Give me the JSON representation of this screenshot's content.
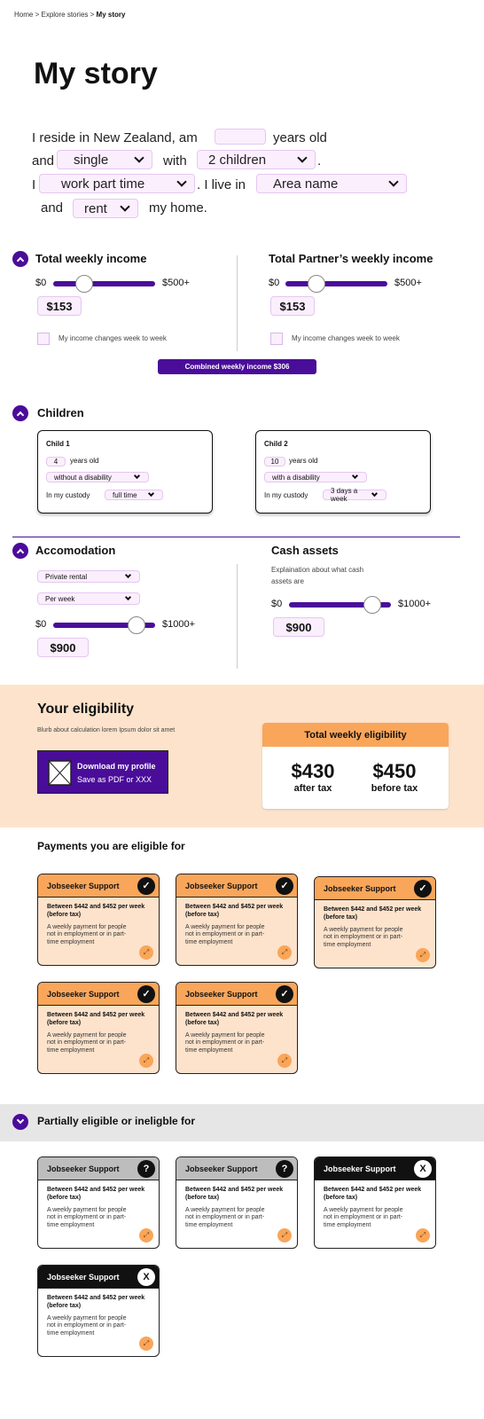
{
  "breadcrumb": {
    "home": "Home",
    "sep1": ">",
    "explore": "Explore stories",
    "sep2": ">",
    "current": "My story"
  },
  "title": "My story",
  "story": {
    "t1": "I reside in New Zealand, am",
    "age_value": "",
    "t2": "years old",
    "t3": "and",
    "status_value": "single",
    "t4": "with",
    "children_value": "2 children",
    "t5": ".",
    "t6": "I",
    "work_value": "work part time",
    "t7": ". I live in",
    "area_value": "Area name",
    "t8": "and",
    "tenure_value": "rent",
    "t9": "my home."
  },
  "income": {
    "title": "Total weekly income",
    "min": "$0",
    "max": "$500+",
    "value": "$153",
    "level": 0.3,
    "checkbox_label": "My income changes week to week"
  },
  "partner_income": {
    "title": "Total Partner’s weekly income",
    "min": "$0",
    "max": "$500+",
    "value": "$153",
    "level": 0.3,
    "checkbox_label": "My income changes week to week"
  },
  "combined": "Combined weekly income $306",
  "children": {
    "title": "Children",
    "items": [
      {
        "name": "Child 1",
        "age": "4",
        "years": "years old",
        "disability": "without a disability",
        "custody_label": "In my custody",
        "custody": "full time"
      },
      {
        "name": "Child 2",
        "age": "10",
        "years": "years old",
        "disability": "with a disability",
        "custody_label": "In my custody",
        "custody": "3 days a week"
      }
    ]
  },
  "accommodation": {
    "title": "Accomodation",
    "type": "Private rental",
    "period": "Per week",
    "min": "$0",
    "max": "$1000+",
    "value": "$900",
    "level": 0.82
  },
  "cash": {
    "title": "Cash assets",
    "explain": "Explaination about what cash assets are",
    "min": "$0",
    "max": "$1000+",
    "value": "$900",
    "level": 0.82
  },
  "eligibility": {
    "title": "Your eligibility",
    "blurb": "Blurb about calculation lorem Ipsum dolor sit amet",
    "download_title": "Download my profile",
    "download_sub": "Save as PDF or XXX",
    "box_title": "Total weekly eligibility",
    "after_amount": "$430",
    "after_label": "after tax",
    "before_amount": "$450",
    "before_label": "before tax"
  },
  "eligible": {
    "title": "Payments you are eligible for",
    "cards": [
      {
        "name": "Jobseeker Support",
        "amount": "Between $442 and $452 per week (before tax)",
        "desc": "A weekly payment for people not in employment or in part-time employment",
        "badge": "✓"
      },
      {
        "name": "Jobseeker Support",
        "amount": "Between $442 and $452 per week (before tax)",
        "desc": "A weekly payment for people not in employment or in part-time employment",
        "badge": "✓"
      },
      {
        "name": "Jobseeker Support",
        "amount": "Between $442 and $452 per week (before tax)",
        "desc": "A weekly payment for people not in employment or in part-time employment",
        "badge": "✓"
      },
      {
        "name": "Jobseeker Support",
        "amount": "Between $442 and $452 per week (before tax)",
        "desc": "A weekly payment for people not in employment or in part-time employment",
        "badge": "✓"
      },
      {
        "name": "Jobseeker Support",
        "amount": "Between $442 and $452 per week (before tax)",
        "desc": "A weekly payment for people not in employment or in part-time employment",
        "badge": "✓"
      }
    ]
  },
  "partial": {
    "title": "Partially eligible or ineligble for",
    "cards": [
      {
        "name": "Jobseeker Support",
        "amount": "Between $442 and $452 per week (before tax)",
        "desc": "A weekly payment for people not in employment or in part-time employment",
        "badge": "?"
      },
      {
        "name": "Jobseeker Support",
        "amount": "Between $442 and $452 per week (before tax)",
        "desc": "A weekly payment for people not in employment or in part-time employment",
        "badge": "?"
      },
      {
        "name": "Jobseeker Support",
        "amount": "Between $442 and $452 per week (before tax)",
        "desc": "A weekly payment for people not in employment or in part-time employment",
        "badge": "X"
      },
      {
        "name": "Jobseeker Support",
        "amount": "Between $442 and $452 per week (before tax)",
        "desc": "A weekly payment for people not in employment or in part-time employment",
        "badge": "X"
      }
    ]
  },
  "colors": {
    "accent": "#4a0d99",
    "field": "#fbeefd",
    "orange": "#f9a65a",
    "peach": "#fde3cc"
  }
}
